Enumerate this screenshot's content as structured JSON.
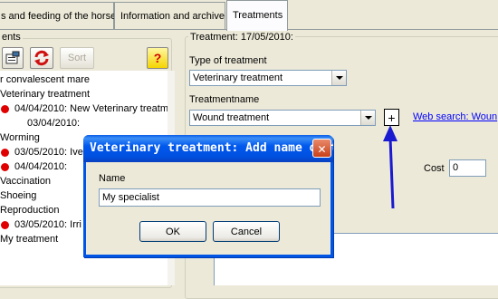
{
  "tabs": [
    {
      "label": "s and feeding of the horse"
    },
    {
      "label": "Information and archive"
    },
    {
      "label": "Treatments"
    }
  ],
  "left": {
    "group_label": "ents",
    "toolbar": {
      "sort_label": "Sort"
    },
    "tree": [
      {
        "text": "r convalescent mare",
        "indent": 0,
        "dot": false
      },
      {
        "text": "Veterinary treatment",
        "indent": 0,
        "dot": false
      },
      {
        "text": "04/04/2010: New Veterinary treatm",
        "indent": 1,
        "dot": true
      },
      {
        "text": "03/04/2010:",
        "indent": 2,
        "dot": false
      },
      {
        "text": "Worming",
        "indent": 0,
        "dot": false
      },
      {
        "text": "03/05/2010: Ive",
        "indent": 1,
        "dot": true
      },
      {
        "text": "04/04/2010:",
        "indent": 1,
        "dot": true
      },
      {
        "text": "Vaccination",
        "indent": 0,
        "dot": false
      },
      {
        "text": "Shoeing",
        "indent": 0,
        "dot": false
      },
      {
        "text": "Reproduction",
        "indent": 0,
        "dot": false
      },
      {
        "text": "03/05/2010: Irri",
        "indent": 1,
        "dot": true
      },
      {
        "text": "My treatment",
        "indent": 0,
        "dot": false
      }
    ]
  },
  "right": {
    "group_label": "Treatment: 17/05/2010:",
    "type_label": "Type of treatment",
    "type_value": "Veterinary treatment",
    "name_label": "Treatmentname",
    "name_value": "Wound treatment",
    "plus_label": "+",
    "link_text": "Web search: Woun",
    "cost_label": "Cost",
    "cost_value": "0"
  },
  "dialog": {
    "title": "Veterinary treatment: Add name of t...",
    "name_label": "Name",
    "name_value": "My specialist",
    "ok_label": "OK",
    "cancel_label": "Cancel"
  },
  "colors": {
    "arrow": "#1a1ad0",
    "title_bar": "#0058ee",
    "dot": "#e00000"
  }
}
